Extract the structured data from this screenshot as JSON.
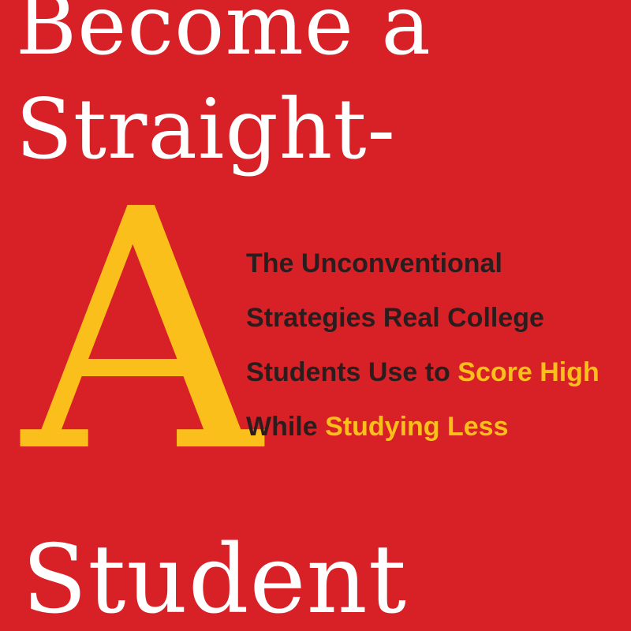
{
  "cover": {
    "title_line_1": "Become a",
    "title_line_2": "Straight-",
    "title_letter": "A",
    "title_line_3": "Student",
    "subtitle": {
      "line_1": "The Unconventional",
      "line_2": "Strategies Real College",
      "line_3_plain": "Students Use to",
      "line_3_accent": "Score High",
      "line_4_plain": "While",
      "line_4_accent": "Studying Less"
    },
    "colors": {
      "background": "#d82127",
      "title": "#ffffff",
      "accent": "#fbbf1c",
      "subtitle": "#2b1d1d"
    }
  }
}
